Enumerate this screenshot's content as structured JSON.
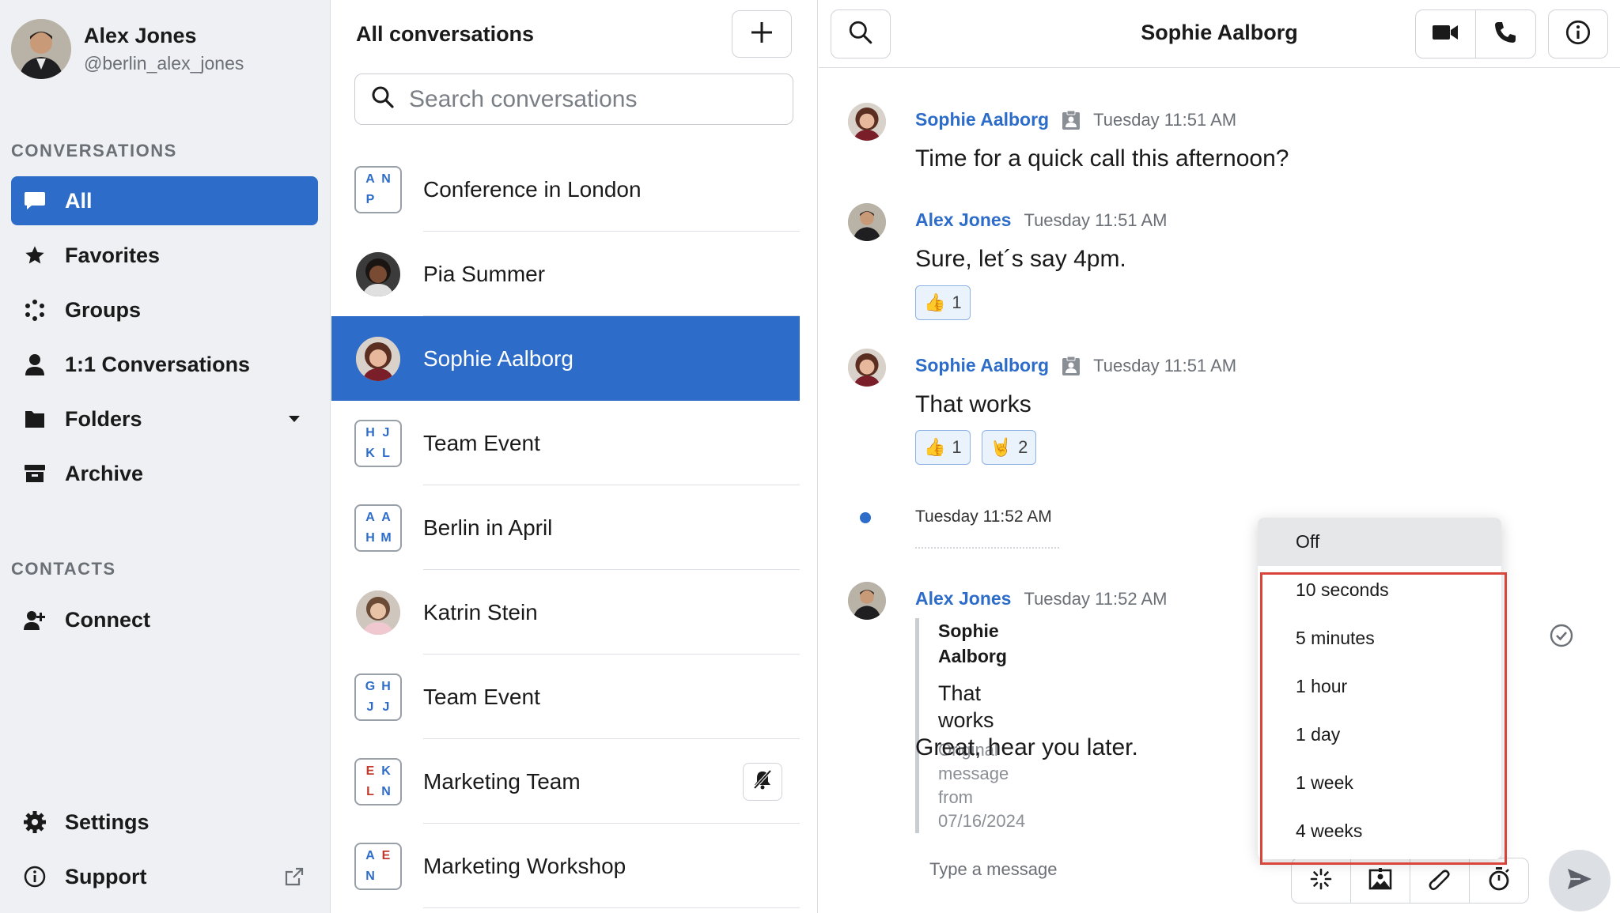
{
  "user": {
    "name": "Alex Jones",
    "handle": "@berlin_alex_jones"
  },
  "sidebar": {
    "conversations_label": "CONVERSATIONS",
    "items": [
      {
        "label": "All",
        "icon": "chat-bubble-icon",
        "active": true
      },
      {
        "label": "Favorites",
        "icon": "star-icon"
      },
      {
        "label": "Groups",
        "icon": "groups-icon"
      },
      {
        "label": "1:1 Conversations",
        "icon": "person-icon"
      },
      {
        "label": "Folders",
        "icon": "folder-icon",
        "trailing": "caret-down-icon"
      },
      {
        "label": "Archive",
        "icon": "archive-icon"
      }
    ],
    "contacts_label": "CONTACTS",
    "contacts_items": [
      {
        "label": "Connect",
        "icon": "add-contact-icon"
      }
    ],
    "bottom_items": [
      {
        "label": "Settings",
        "icon": "gear-icon"
      },
      {
        "label": "Support",
        "icon": "info-icon",
        "trailing": "external-link-icon"
      }
    ]
  },
  "conversation_list": {
    "title": "All conversations",
    "search_placeholder": "Search conversations",
    "items": [
      {
        "name": "Conference in London",
        "type": "group",
        "initials": [
          "A",
          "N",
          "P"
        ],
        "initial_colors": [
          "blue",
          "blue",
          "blue"
        ]
      },
      {
        "name": "Pia Summer",
        "type": "person"
      },
      {
        "name": "Sophie Aalborg",
        "type": "person",
        "active": true
      },
      {
        "name": "Team Event",
        "type": "group",
        "initials": [
          "H",
          "J",
          "K",
          "L"
        ],
        "initial_colors": [
          "blue",
          "blue",
          "blue",
          "blue"
        ]
      },
      {
        "name": "Berlin in April",
        "type": "group",
        "initials": [
          "A",
          "A",
          "H",
          "M"
        ],
        "initial_colors": [
          "blue",
          "blue",
          "blue",
          "blue"
        ]
      },
      {
        "name": "Katrin Stein",
        "type": "person"
      },
      {
        "name": "Team Event",
        "type": "group",
        "initials": [
          "G",
          "H",
          "J",
          "J"
        ],
        "initial_colors": [
          "blue",
          "blue",
          "blue",
          "blue"
        ]
      },
      {
        "name": "Marketing Team",
        "type": "group",
        "initials": [
          "E",
          "K",
          "L",
          "N"
        ],
        "initial_colors": [
          "red",
          "blue",
          "red",
          "blue"
        ],
        "muted": true
      },
      {
        "name": "Marketing Workshop",
        "type": "group",
        "initials": [
          "A",
          "E",
          "N"
        ],
        "initial_colors": [
          "blue",
          "red",
          "blue"
        ]
      }
    ]
  },
  "chat": {
    "title": "Sophie Aalborg",
    "messages": [
      {
        "sender": "Sophie Aalborg",
        "time": "Tuesday 11:51 AM",
        "text": "Time for a quick call this afternoon?",
        "external": true
      },
      {
        "sender": "Alex Jones",
        "time": "Tuesday 11:51 AM",
        "text": "Sure, let´s say 4pm.",
        "reactions": [
          {
            "emoji": "👍",
            "count": "1"
          }
        ]
      },
      {
        "sender": "Sophie Aalborg",
        "time": "Tuesday 11:51 AM",
        "text": "That works",
        "external": true,
        "reactions": [
          {
            "emoji": "👍",
            "count": "1"
          },
          {
            "emoji": "🤘",
            "count": "2"
          }
        ]
      },
      {
        "sender": "Alex Jones",
        "time": "Tuesday 11:52 AM",
        "text": "Great, hear you later.",
        "quote": {
          "sender": "Sophie Aalborg",
          "text": "That works",
          "original": "Original message from 07/16/2024"
        }
      }
    ],
    "divider_time": "Tuesday 11:52 AM",
    "composer_placeholder": "Type a message"
  },
  "timer_dropdown": {
    "options": [
      "Off",
      "10 seconds",
      "5 minutes",
      "1 hour",
      "1 day",
      "1 week",
      "4 weeks"
    ],
    "selected": "Off"
  },
  "colors": {
    "accent": "#2d6cc8",
    "highlight_box": "#d9453b",
    "red_initial": "#c0392b"
  }
}
